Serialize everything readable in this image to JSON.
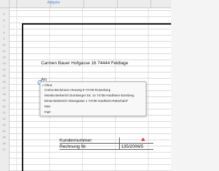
{
  "header": {
    "column_label": "Aufgabe"
  },
  "rows": [
    "5",
    "6",
    "7",
    "8",
    "9",
    "10",
    "11",
    "12",
    "13",
    "14",
    "15",
    "16",
    "17",
    "18",
    "19",
    "20",
    "21",
    "22",
    "23",
    "24",
    "25",
    "26",
    "27"
  ],
  "letter": {
    "sender_line": "Carmen Bauer Hofgasse 16 74444 Feldlage",
    "an_label": "An"
  },
  "dropdown": {
    "checked_index": 0,
    "options": [
      "Ohne",
      "Corina Beckmann     Heuweg 9     74749 Rosenberg",
      "Monika Berberich Dornberger Str. 14 74736 Hardheim-Dornberg",
      "Elmar Berberich Hirtengasse 1 74736 Hardheim-Rütschdorf",
      "Max",
      "Inge"
    ]
  },
  "footer": {
    "kundennummer_label": "Kundennummer:",
    "rechnung_label": "Rechnung Nr.",
    "rechnung_value": "135/2006/5"
  },
  "colors": {
    "accent": "#4a90d9",
    "warning": "#e53935"
  }
}
